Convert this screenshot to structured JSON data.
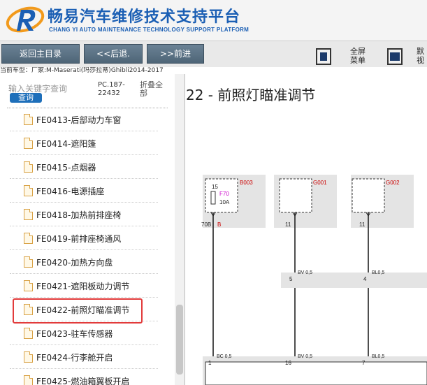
{
  "header": {
    "title": "畅易汽车维修技术支持平台",
    "subtitle": "CHANG YI AUTO MAINTENANCE TECHNOLOGY SUPPORT PLATFORM"
  },
  "toolbar": {
    "home_label": "返回主目录",
    "back_label": "<<后退.",
    "forward_label": ">>前进",
    "fullscreen_label_1": "全屏",
    "fullscreen_label_2": "菜单",
    "partial_label_1": "默",
    "partial_label_2": "视"
  },
  "vehicle_line": "当前车型：厂家:M-Maserati(玛莎拉蒂)Ghibli2014-2017",
  "search": {
    "placeholder": "输入关键字查询",
    "button_label": "查询",
    "pc_line1": "PC.187-",
    "pc_line2": "22432",
    "collapse_label": "折叠全部"
  },
  "tree_items": [
    {
      "label": "FE0413-后部动力车窗"
    },
    {
      "label": "FE0414-遮阳篷"
    },
    {
      "label": "FE0415-点烟器"
    },
    {
      "label": "FE0416-电源插座"
    },
    {
      "label": "FE0418-加热前排座椅"
    },
    {
      "label": "FE0419-前排座椅通风"
    },
    {
      "label": "FE0420-加热方向盘"
    },
    {
      "label": "FE0421-遮阳板动力调节"
    },
    {
      "label": "FE0422-前照灯瞄准调节"
    },
    {
      "label": "FE0423-驻车传感器"
    },
    {
      "label": "FE0424-行李舱开启"
    },
    {
      "label": "FE0425-燃油箱翼板开启"
    }
  ],
  "content": {
    "title": "22 - 前照灯瞄准调节"
  },
  "diagram": {
    "modules": [
      {
        "code": "B003",
        "fuse": "F70",
        "number": "15",
        "rating": "10A",
        "pin": "70B",
        "pin_color": "B"
      },
      {
        "code": "G001",
        "pin": "11"
      },
      {
        "code": "G002",
        "pin": "11"
      }
    ],
    "wires": [
      {
        "label": "BV 0,5",
        "pin": "5"
      },
      {
        "label": "BL0,5",
        "pin": "4"
      }
    ],
    "bottom_wires": [
      {
        "label": "BC 0,5",
        "pin": "1"
      },
      {
        "label": "BV 0,5",
        "pin": "16"
      },
      {
        "label": "BL0,5",
        "pin": "7"
      }
    ]
  },
  "colors": {
    "brand_blue": "#1b5fb4",
    "nav_button": "#5b7386",
    "query_button": "#1e6fba",
    "highlight_red": "#e23b3b",
    "module_code_red": "#cc0000",
    "fuse_magenta": "#cc00cc"
  }
}
